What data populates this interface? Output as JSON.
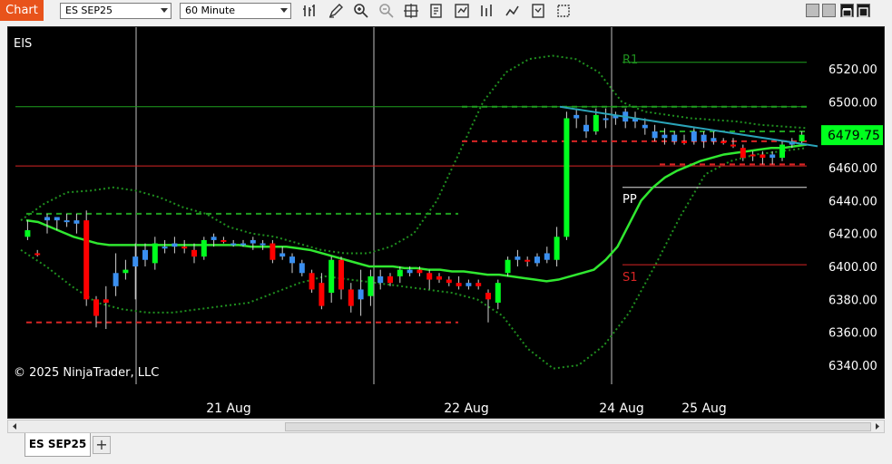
{
  "toolbar": {
    "window_label": "Chart",
    "instrument": "ES SEP25",
    "interval": "60 Minute",
    "icons": [
      "bar-type-icon",
      "draw-pencil-icon",
      "zoom-in-icon",
      "zoom-out-icon",
      "crosshair-icon",
      "data-box-icon",
      "indicators-icon",
      "strategies-icon",
      "chart-trader-icon",
      "properties-icon",
      "snapshot-icon"
    ]
  },
  "window_controls": [
    "restore-icon",
    "minimize-icon",
    "maximize-icon",
    "close-icon"
  ],
  "chart": {
    "instrument_label": "EIS",
    "copyright": "© 2025 NinjaTrader, LLC",
    "price_axis": [
      "6520.00",
      "6500.00",
      "6480.00",
      "6460.00",
      "6440.00",
      "6420.00",
      "6400.00",
      "6380.00",
      "6360.00",
      "6340.00"
    ],
    "last_price": "6479.75",
    "time_axis": [
      "21 Aug",
      "22 Aug",
      "24 Aug",
      "25 Aug"
    ],
    "pivot_labels": {
      "r1": "R1",
      "pp": "PP",
      "s1": "S1"
    },
    "colors": {
      "background": "#000000",
      "up": "#00ff1e",
      "down": "#ff0000",
      "blue": "#3a8ff0",
      "ma": "#30e830",
      "envelope": "#1f8f1f",
      "last_price_bg": "#00ff1e",
      "pivot_red": "#d82424",
      "trendline": "#2aa3b8"
    }
  },
  "chart_data": {
    "type": "candlestick",
    "ylim": [
      6330,
      6530
    ],
    "xlabel": "",
    "ylabel": "",
    "candles": [
      {
        "o": 6418,
        "c": 6422,
        "h": 6428,
        "l": 6416,
        "color": "green"
      },
      {
        "o": 6408,
        "c": 6408,
        "h": 6410,
        "l": 6406,
        "color": "red"
      },
      {
        "o": 6428,
        "c": 6430,
        "h": 6432,
        "l": 6420,
        "color": "blue"
      },
      {
        "o": 6430,
        "c": 6428,
        "h": 6430,
        "l": 6422,
        "color": "blue"
      },
      {
        "o": 6428,
        "c": 6428,
        "h": 6432,
        "l": 6424,
        "color": "blue"
      },
      {
        "o": 6428,
        "c": 6426,
        "h": 6432,
        "l": 6420,
        "color": "blue"
      },
      {
        "o": 6428,
        "c": 6380,
        "h": 6434,
        "l": 6376,
        "color": "red"
      },
      {
        "o": 6380,
        "c": 6370,
        "h": 6382,
        "l": 6363,
        "color": "red"
      },
      {
        "o": 6378,
        "c": 6380,
        "h": 6388,
        "l": 6362,
        "color": "red"
      },
      {
        "o": 6388,
        "c": 6396,
        "h": 6408,
        "l": 6382,
        "color": "blue"
      },
      {
        "o": 6396,
        "c": 6398,
        "h": 6404,
        "l": 6392,
        "color": "green"
      },
      {
        "o": 6400,
        "c": 6406,
        "h": 6414,
        "l": 6380,
        "color": "blue"
      },
      {
        "o": 6404,
        "c": 6410,
        "h": 6414,
        "l": 6400,
        "color": "blue"
      },
      {
        "o": 6402,
        "c": 6414,
        "h": 6418,
        "l": 6398,
        "color": "green"
      },
      {
        "o": 6412,
        "c": 6412,
        "h": 6416,
        "l": 6408,
        "color": "blue"
      },
      {
        "o": 6412,
        "c": 6414,
        "h": 6418,
        "l": 6408,
        "color": "blue"
      },
      {
        "o": 6412,
        "c": 6412,
        "h": 6416,
        "l": 6408,
        "color": "red"
      },
      {
        "o": 6406,
        "c": 6410,
        "h": 6414,
        "l": 6402,
        "color": "red"
      },
      {
        "o": 6406,
        "c": 6416,
        "h": 6418,
        "l": 6404,
        "color": "green"
      },
      {
        "o": 6416,
        "c": 6418,
        "h": 6420,
        "l": 6412,
        "color": "blue"
      },
      {
        "o": 6416,
        "c": 6416,
        "h": 6418,
        "l": 6414,
        "color": "red"
      },
      {
        "o": 6414,
        "c": 6414,
        "h": 6416,
        "l": 6412,
        "color": "blue"
      },
      {
        "o": 6414,
        "c": 6414,
        "h": 6416,
        "l": 6412,
        "color": "blue"
      },
      {
        "o": 6414,
        "c": 6416,
        "h": 6418,
        "l": 6410,
        "color": "blue"
      },
      {
        "o": 6414,
        "c": 6414,
        "h": 6416,
        "l": 6410,
        "color": "blue"
      },
      {
        "o": 6414,
        "c": 6404,
        "h": 6416,
        "l": 6402,
        "color": "red"
      },
      {
        "o": 6406,
        "c": 6408,
        "h": 6412,
        "l": 6404,
        "color": "blue"
      },
      {
        "o": 6406,
        "c": 6402,
        "h": 6408,
        "l": 6396,
        "color": "blue"
      },
      {
        "o": 6402,
        "c": 6396,
        "h": 6404,
        "l": 6394,
        "color": "blue"
      },
      {
        "o": 6396,
        "c": 6386,
        "h": 6398,
        "l": 6384,
        "color": "red"
      },
      {
        "o": 6390,
        "c": 6376,
        "h": 6396,
        "l": 6374,
        "color": "red"
      },
      {
        "o": 6384,
        "c": 6404,
        "h": 6406,
        "l": 6378,
        "color": "green"
      },
      {
        "o": 6404,
        "c": 6386,
        "h": 6406,
        "l": 6380,
        "color": "red"
      },
      {
        "o": 6386,
        "c": 6376,
        "h": 6390,
        "l": 6372,
        "color": "red"
      },
      {
        "o": 6380,
        "c": 6386,
        "h": 6398,
        "l": 6370,
        "color": "blue"
      },
      {
        "o": 6382,
        "c": 6394,
        "h": 6398,
        "l": 6376,
        "color": "green"
      },
      {
        "o": 6390,
        "c": 6394,
        "h": 6398,
        "l": 6386,
        "color": "blue"
      },
      {
        "o": 6394,
        "c": 6390,
        "h": 6396,
        "l": 6388,
        "color": "red"
      },
      {
        "o": 6394,
        "c": 6398,
        "h": 6400,
        "l": 6390,
        "color": "green"
      },
      {
        "o": 6396,
        "c": 6398,
        "h": 6400,
        "l": 6394,
        "color": "blue"
      },
      {
        "o": 6398,
        "c": 6396,
        "h": 6400,
        "l": 6394,
        "color": "red"
      },
      {
        "o": 6396,
        "c": 6392,
        "h": 6398,
        "l": 6386,
        "color": "red"
      },
      {
        "o": 6394,
        "c": 6392,
        "h": 6396,
        "l": 6390,
        "color": "red"
      },
      {
        "o": 6392,
        "c": 6390,
        "h": 6394,
        "l": 6388,
        "color": "red"
      },
      {
        "o": 6390,
        "c": 6388,
        "h": 6394,
        "l": 6386,
        "color": "red"
      },
      {
        "o": 6390,
        "c": 6388,
        "h": 6392,
        "l": 6386,
        "color": "blue"
      },
      {
        "o": 6390,
        "c": 6388,
        "h": 6392,
        "l": 6386,
        "color": "red"
      },
      {
        "o": 6384,
        "c": 6380,
        "h": 6386,
        "l": 6366,
        "color": "red"
      },
      {
        "o": 6378,
        "c": 6390,
        "h": 6392,
        "l": 6374,
        "color": "green"
      },
      {
        "o": 6396,
        "c": 6404,
        "h": 6406,
        "l": 6394,
        "color": "green"
      },
      {
        "o": 6404,
        "c": 6406,
        "h": 6410,
        "l": 6400,
        "color": "blue"
      },
      {
        "o": 6404,
        "c": 6404,
        "h": 6406,
        "l": 6400,
        "color": "red"
      },
      {
        "o": 6402,
        "c": 6406,
        "h": 6408,
        "l": 6400,
        "color": "blue"
      },
      {
        "o": 6404,
        "c": 6408,
        "h": 6412,
        "l": 6402,
        "color": "blue"
      },
      {
        "o": 6404,
        "c": 6418,
        "h": 6424,
        "l": 6400,
        "color": "green"
      },
      {
        "o": 6418,
        "c": 6490,
        "h": 6494,
        "l": 6416,
        "color": "green"
      },
      {
        "o": 6490,
        "c": 6492,
        "h": 6496,
        "l": 6484,
        "color": "blue"
      },
      {
        "o": 6482,
        "c": 6486,
        "h": 6492,
        "l": 6478,
        "color": "blue"
      },
      {
        "o": 6482,
        "c": 6492,
        "h": 6496,
        "l": 6480,
        "color": "green"
      },
      {
        "o": 6490,
        "c": 6490,
        "h": 6496,
        "l": 6484,
        "color": "blue"
      },
      {
        "o": 6490,
        "c": 6492,
        "h": 6494,
        "l": 6486,
        "color": "blue"
      },
      {
        "o": 6488,
        "c": 6494,
        "h": 6496,
        "l": 6484,
        "color": "blue"
      },
      {
        "o": 6490,
        "c": 6488,
        "h": 6494,
        "l": 6484,
        "color": "blue"
      },
      {
        "o": 6486,
        "c": 6484,
        "h": 6490,
        "l": 6480,
        "color": "blue"
      },
      {
        "o": 6482,
        "c": 6478,
        "h": 6486,
        "l": 6476,
        "color": "blue"
      },
      {
        "o": 6478,
        "c": 6480,
        "h": 6484,
        "l": 6474,
        "color": "blue"
      },
      {
        "o": 6480,
        "c": 6476,
        "h": 6482,
        "l": 6474,
        "color": "blue"
      },
      {
        "o": 6476,
        "c": 6476,
        "h": 6480,
        "l": 6474,
        "color": "red"
      },
      {
        "o": 6476,
        "c": 6482,
        "h": 6484,
        "l": 6474,
        "color": "blue"
      },
      {
        "o": 6480,
        "c": 6476,
        "h": 6482,
        "l": 6472,
        "color": "blue"
      },
      {
        "o": 6476,
        "c": 6478,
        "h": 6482,
        "l": 6474,
        "color": "blue"
      },
      {
        "o": 6476,
        "c": 6476,
        "h": 6478,
        "l": 6474,
        "color": "red"
      },
      {
        "o": 6474,
        "c": 6474,
        "h": 6478,
        "l": 6472,
        "color": "red"
      },
      {
        "o": 6472,
        "c": 6466,
        "h": 6474,
        "l": 6464,
        "color": "red"
      },
      {
        "o": 6468,
        "c": 6468,
        "h": 6470,
        "l": 6464,
        "color": "red"
      },
      {
        "o": 6468,
        "c": 6466,
        "h": 6470,
        "l": 6462,
        "color": "red"
      },
      {
        "o": 6466,
        "c": 6468,
        "h": 6470,
        "l": 6462,
        "color": "blue"
      },
      {
        "o": 6466,
        "c": 6474,
        "h": 6476,
        "l": 6464,
        "color": "green"
      },
      {
        "o": 6474,
        "c": 6476,
        "h": 6478,
        "l": 6472,
        "color": "blue"
      },
      {
        "o": 6476,
        "c": 6480,
        "h": 6482,
        "l": 6474,
        "color": "green"
      }
    ],
    "moving_average": [
      6428,
      6427,
      6424,
      6421,
      6418,
      6416,
      6414,
      6413,
      6413,
      6413,
      6413,
      6413,
      6413,
      6413,
      6413,
      6413,
      6413,
      6413,
      6413,
      6412,
      6412,
      6412,
      6412,
      6411,
      6410,
      6408,
      6406,
      6404,
      6402,
      6400,
      6400,
      6400,
      6399,
      6399,
      6398,
      6398,
      6397,
      6397,
      6396,
      6395,
      6395,
      6394,
      6393,
      6392,
      6391,
      6392,
      6394,
      6396,
      6398,
      6404,
      6412,
      6426,
      6440,
      6448,
      6454,
      6458,
      6461,
      6464,
      6466,
      6468,
      6469,
      6470,
      6471,
      6472,
      6472,
      6473,
      6474
    ],
    "envelope_upper": [
      6428,
      6438,
      6445,
      6446,
      6448,
      6446,
      6442,
      6436,
      6432,
      6424,
      6420,
      6418,
      6414,
      6410,
      6408,
      6408,
      6412,
      6420,
      6440,
      6470,
      6500,
      6518,
      6526,
      6528,
      6526,
      6518,
      6500,
      6494,
      6492,
      6490,
      6489,
      6488,
      6486,
      6485,
      6484
    ],
    "envelope_lower": [
      6410,
      6400,
      6388,
      6378,
      6374,
      6372,
      6372,
      6374,
      6376,
      6378,
      6384,
      6390,
      6394,
      6392,
      6390,
      6388,
      6386,
      6384,
      6380,
      6370,
      6350,
      6338,
      6340,
      6352,
      6372,
      6400,
      6430,
      6456,
      6464,
      6468,
      6470,
      6472
    ],
    "horizontal_lines": [
      {
        "price": 6497,
        "color": "green",
        "style": "solid",
        "label": ""
      },
      {
        "price": 6461,
        "color": "red",
        "style": "solid",
        "label": ""
      },
      {
        "price": 6432,
        "color": "green",
        "style": "dashed",
        "label": ""
      },
      {
        "price": 6366,
        "color": "red",
        "style": "dashed",
        "label": ""
      },
      {
        "price": 6476,
        "color": "red",
        "style": "dashed",
        "label": ""
      },
      {
        "price": 6497,
        "color": "green",
        "style": "dashed",
        "label": ""
      },
      {
        "price": 6462,
        "color": "red",
        "style": "dashed",
        "label": ""
      },
      {
        "price": 6482,
        "color": "green",
        "style": "dashed",
        "label": ""
      },
      {
        "price": 6524,
        "color": "green",
        "style": "solid",
        "label": "R1"
      },
      {
        "price": 6448,
        "color": "white",
        "style": "solid",
        "label": "PP"
      },
      {
        "price": 6401,
        "color": "red",
        "style": "solid",
        "label": "S1"
      }
    ],
    "trendline": {
      "from": 6497,
      "to": 6473
    }
  }
}
